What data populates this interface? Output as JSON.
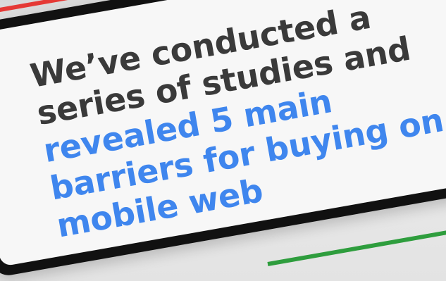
{
  "message": {
    "lines": [
      "We’ve conducted a",
      "series of studies and",
      "revealed 5 main",
      "barriers for buying on",
      "mobile web"
    ]
  },
  "colors": {
    "dark_text": "#3a3a3a",
    "accent_blue": "#3f86ee",
    "accent_red": "#e53935",
    "accent_green": "#2e9d3d",
    "screen_bg": "#f7f7f7"
  }
}
